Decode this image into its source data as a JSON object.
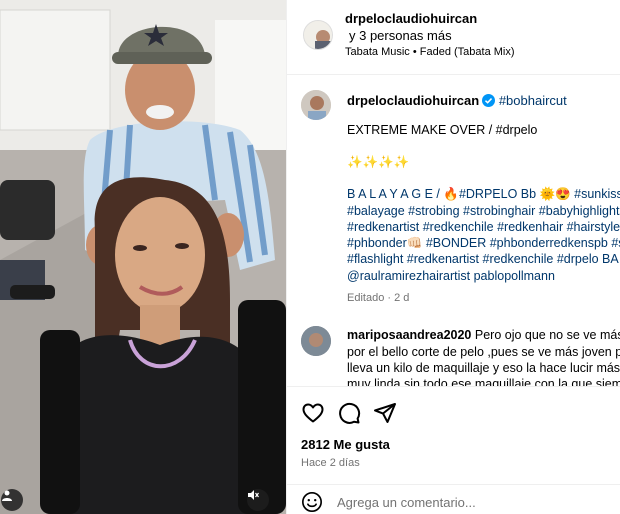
{
  "post": {
    "author": "drpeloclaudiohuircan",
    "collaborators": "y 3 personas más",
    "audio": "Tabata Music • Faded (Tabata Mix)"
  },
  "caption": {
    "username": "drpeloclaudiohuircan",
    "first_tag": "#bobhaircut",
    "lines": [
      "EXTREME MAKE OVER / #drpelo",
      "✨✨✨✨",
      "B A L A Y A G E / 🔥#DRPELO Bb 🌞😍 #sunkiss #",
      "#balayage #strobing #strobinghair #babyhighlights",
      "#redkenartist #redkenchile #redkenhair #hairstyle",
      "#phbonder👊🏻 #BONDER #phbonderredkenspb #s",
      "#flashlight #redkenartist #redkenchile #drpelo BA",
      "@raulramirezhairartist pablopollmann"
    ],
    "edited": "Editado · 2 d"
  },
  "comment": {
    "username": "mariposaandrea2020",
    "lines": [
      "Pero ojo que no se ve más j",
      "por el bello corte de pelo ,pues se ve más joven p",
      "lleva un kilo de maquillaje y eso la hace lucir más",
      "muy linda sin todo ese maquillaje con la que siem"
    ]
  },
  "actions": {
    "likes": "2812 Me gusta",
    "time_ago": "Hace 2 días",
    "icons": [
      "heart-icon",
      "comment-icon",
      "share-icon"
    ]
  },
  "composer": {
    "placeholder": "Agrega un comentario..."
  },
  "colors": {
    "link": "#00376b",
    "muted": "#737373",
    "verified": "#0095f6",
    "border": "#efefef"
  }
}
